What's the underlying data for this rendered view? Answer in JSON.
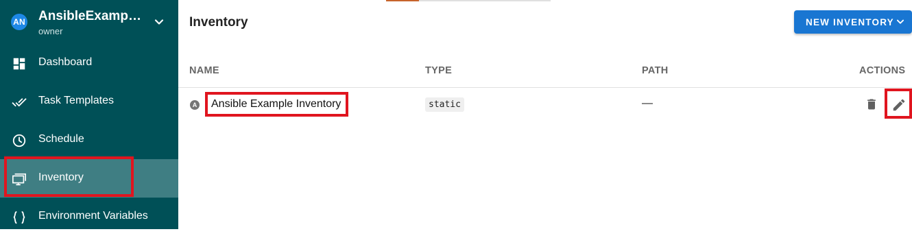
{
  "project": {
    "avatar_initials": "AN",
    "name": "AnsibleExampl…",
    "role": "owner",
    "chevron_icon": "chevron-down-icon"
  },
  "sidebar": {
    "items": [
      {
        "label": "Dashboard",
        "icon": "dashboard-icon"
      },
      {
        "label": "Task Templates",
        "icon": "done-all-icon"
      },
      {
        "label": "Schedule",
        "icon": "clock-icon"
      },
      {
        "label": "Inventory",
        "icon": "monitor-icon",
        "active": true
      },
      {
        "label": "Environment Variables",
        "icon": "braces-icon"
      }
    ]
  },
  "header": {
    "title": "Inventory",
    "new_button_label": "NEW INVENTORY"
  },
  "table": {
    "columns": [
      "NAME",
      "TYPE",
      "PATH",
      "ACTIONS"
    ],
    "rows": [
      {
        "icon_letter": "A",
        "name": "Ansible Example Inventory",
        "type": "static",
        "path": "—"
      }
    ]
  },
  "colors": {
    "sidebar_bg": "#005057",
    "active_item_bg": "#3f7e83",
    "primary_button": "#1976d2",
    "highlight": "#e0151f"
  }
}
